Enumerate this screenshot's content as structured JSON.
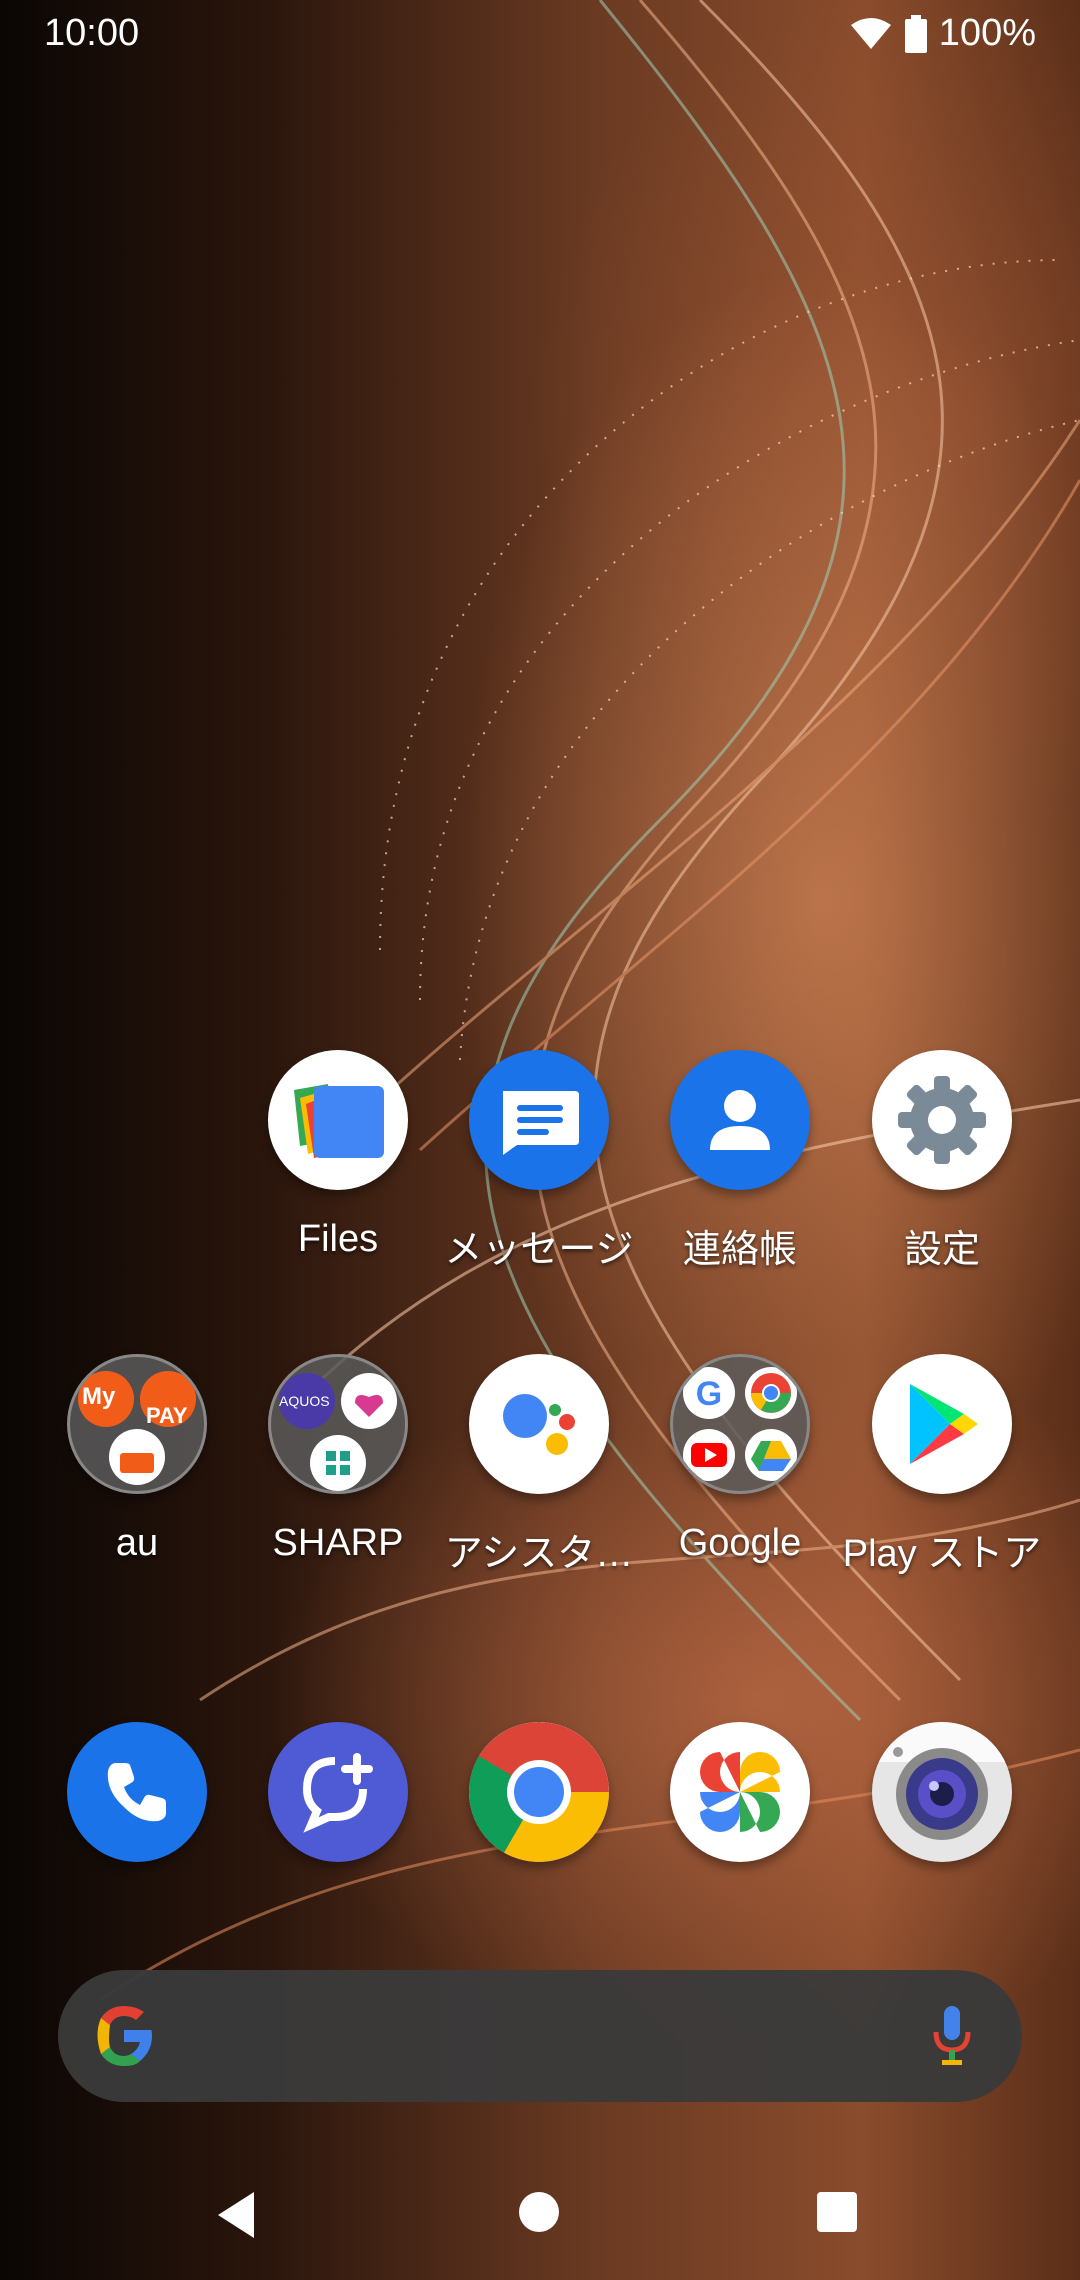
{
  "status_bar": {
    "time": "10:00",
    "battery_text": "100%",
    "icons": [
      "wifi-icon",
      "battery-icon"
    ]
  },
  "home": {
    "row1": [
      {
        "label": "Files",
        "icon": "files-icon"
      },
      {
        "label": "メッセージ",
        "icon": "messages-icon"
      },
      {
        "label": "連絡帳",
        "icon": "contacts-icon"
      },
      {
        "label": "設定",
        "icon": "settings-icon"
      }
    ],
    "row2": [
      {
        "label": "au",
        "icon": "au-folder-icon"
      },
      {
        "label": "SHARP",
        "icon": "sharp-folder-icon"
      },
      {
        "label": "アシスタ…",
        "icon": "assistant-icon"
      },
      {
        "label": "Google",
        "icon": "google-folder-icon"
      },
      {
        "label": "Play ストア",
        "icon": "play-store-icon"
      }
    ],
    "dock": [
      {
        "icon": "phone-icon"
      },
      {
        "icon": "plus-message-icon"
      },
      {
        "icon": "chrome-icon"
      },
      {
        "icon": "photos-icon"
      },
      {
        "icon": "camera-icon"
      }
    ],
    "folder_tiles": {
      "au_my": "My",
      "au_pay": "PAY",
      "sharp_aquos": "AQUOS"
    }
  },
  "search": {
    "icons": [
      "google-g-icon",
      "microphone-icon"
    ]
  },
  "navigation": {
    "icons": [
      "back-icon",
      "home-icon",
      "recents-icon"
    ]
  },
  "colors": {
    "accent_blue": "#1a73e8",
    "google_red": "#ea4335",
    "google_yellow": "#fbbc04",
    "google_green": "#34a853",
    "search_bg": "#3a3a3a"
  }
}
